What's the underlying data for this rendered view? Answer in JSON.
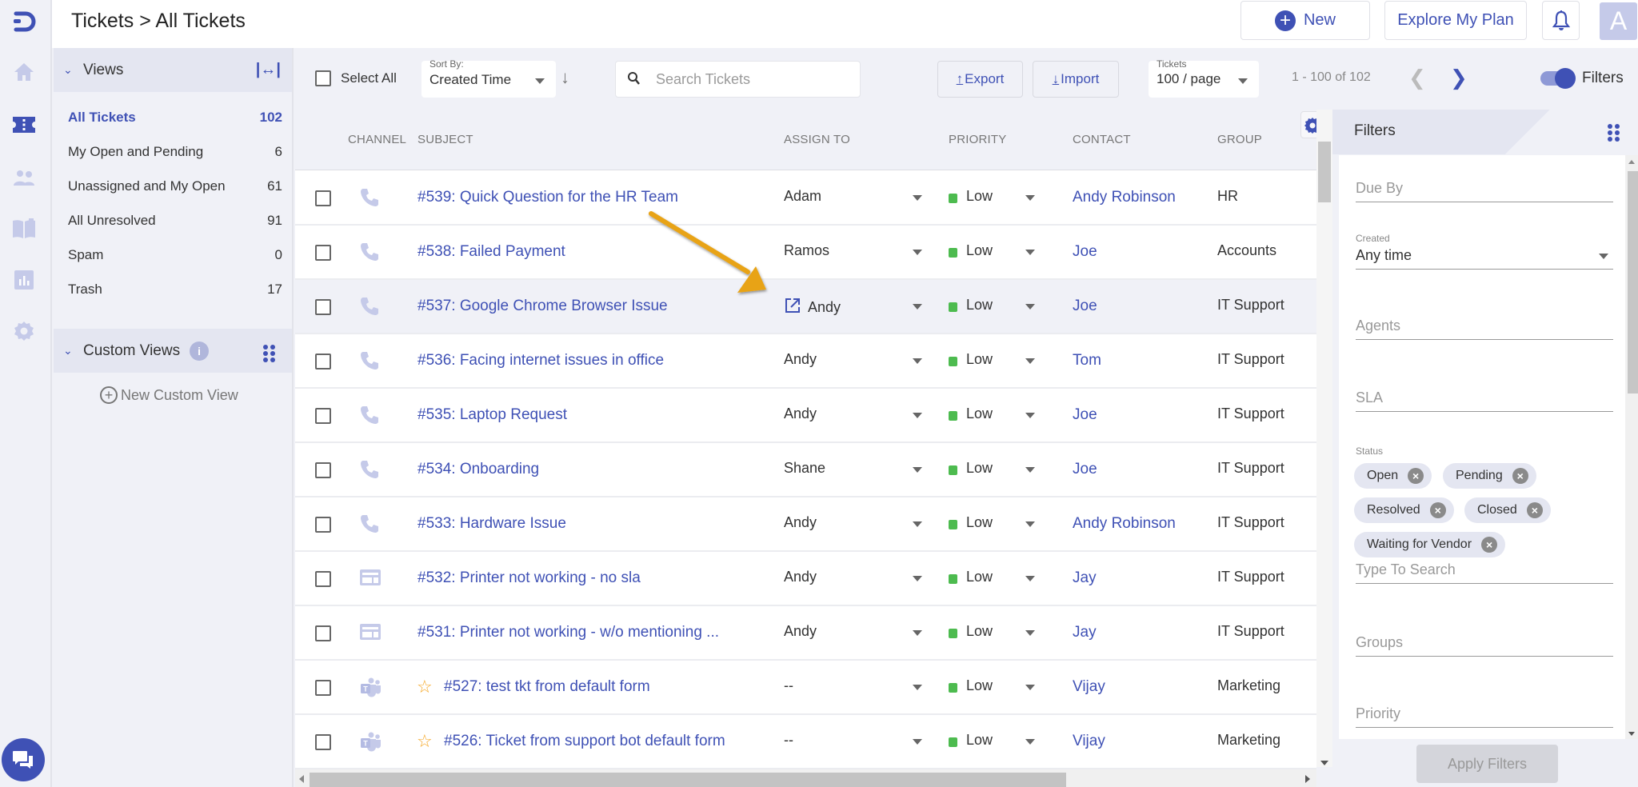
{
  "header": {
    "title": "Tickets > All Tickets",
    "new_label": "New",
    "explore_label": "Explore My Plan",
    "avatar_letter": "A"
  },
  "rail": {
    "icons": [
      "home-icon",
      "tickets-icon",
      "contacts-icon",
      "knowledge-base-icon",
      "reports-icon",
      "settings-icon"
    ],
    "active": "tickets-icon"
  },
  "views": {
    "section_label": "Views",
    "items": [
      {
        "label": "All Tickets",
        "count": "102",
        "active": true
      },
      {
        "label": "My Open and Pending",
        "count": "6"
      },
      {
        "label": "Unassigned and My Open",
        "count": "61"
      },
      {
        "label": "All Unresolved",
        "count": "91"
      },
      {
        "label": "Spam",
        "count": "0"
      },
      {
        "label": "Trash",
        "count": "17"
      }
    ],
    "custom_section_label": "Custom Views",
    "new_custom_view_label": "New Custom View"
  },
  "toolbar": {
    "select_all_label": "Select All",
    "sort_by_label": "Sort By:",
    "sort_by_value": "Created Time",
    "search_placeholder": "Search Tickets",
    "export_label": "Export",
    "import_label": "Import",
    "per_page_label": "Tickets",
    "per_page_value": "100 / page",
    "range_text": "1 - 100 of 102",
    "filters_toggle_label": "Filters",
    "filters_toggle_on": true
  },
  "table": {
    "columns": [
      "CHANNEL",
      "SUBJECT",
      "ASSIGN TO",
      "PRIORITY",
      "CONTACT",
      "GROUP"
    ],
    "rows": [
      {
        "channel": "phone",
        "subject": "#539: Quick Question for the HR Team",
        "assign": "Adam",
        "priority": "Low",
        "contact": "Andy Robinson",
        "group": "HR"
      },
      {
        "channel": "phone",
        "subject": "#538: Failed Payment",
        "assign": "Ramos",
        "priority": "Low",
        "contact": "Joe",
        "group": "Accounts"
      },
      {
        "channel": "phone",
        "subject": "#537: Google Chrome Browser Issue",
        "assign": "Andy",
        "priority": "Low",
        "contact": "Joe",
        "group": "IT Support",
        "highlighted": true
      },
      {
        "channel": "phone",
        "subject": "#536: Facing internet issues in office",
        "assign": "Andy",
        "priority": "Low",
        "contact": "Tom",
        "group": "IT Support"
      },
      {
        "channel": "phone",
        "subject": "#535: Laptop Request",
        "assign": "Andy",
        "priority": "Low",
        "contact": "Joe",
        "group": "IT Support"
      },
      {
        "channel": "phone",
        "subject": "#534: Onboarding",
        "assign": "Shane",
        "priority": "Low",
        "contact": "Joe",
        "group": "IT Support"
      },
      {
        "channel": "phone",
        "subject": "#533: Hardware Issue",
        "assign": "Andy",
        "priority": "Low",
        "contact": "Andy Robinson",
        "group": "IT Support"
      },
      {
        "channel": "form",
        "subject": "#532: Printer not working - no sla",
        "assign": "Andy",
        "priority": "Low",
        "contact": "Jay",
        "group": "IT Support"
      },
      {
        "channel": "form",
        "subject": "#531: Printer not working - w/o mentioning ...",
        "assign": "Andy",
        "priority": "Low",
        "contact": "Jay",
        "group": "IT Support"
      },
      {
        "channel": "teams",
        "subject": "#527: test tkt from default form",
        "assign": "--",
        "priority": "Low",
        "contact": "Vijay",
        "group": "Marketing",
        "starred": true
      },
      {
        "channel": "teams",
        "subject": "#526: Ticket from support bot default form",
        "assign": "--",
        "priority": "Low",
        "contact": "Vijay",
        "group": "Marketing",
        "starred": true
      }
    ]
  },
  "filters": {
    "title": "Filters",
    "due_by_placeholder": "Due By",
    "created_label": "Created",
    "created_value": "Any time",
    "agents_placeholder": "Agents",
    "sla_placeholder": "SLA",
    "status_label": "Status",
    "status_chips": [
      "Open",
      "Pending",
      "Resolved",
      "Closed",
      "Waiting for Vendor"
    ],
    "status_search_placeholder": "Type To Search",
    "groups_placeholder": "Groups",
    "priority_placeholder": "Priority",
    "apply_label": "Apply Filters"
  },
  "colors": {
    "brand": "#3f51b5",
    "priority_low": "#4dbb4f",
    "annotation_arrow": "#e8a317"
  }
}
